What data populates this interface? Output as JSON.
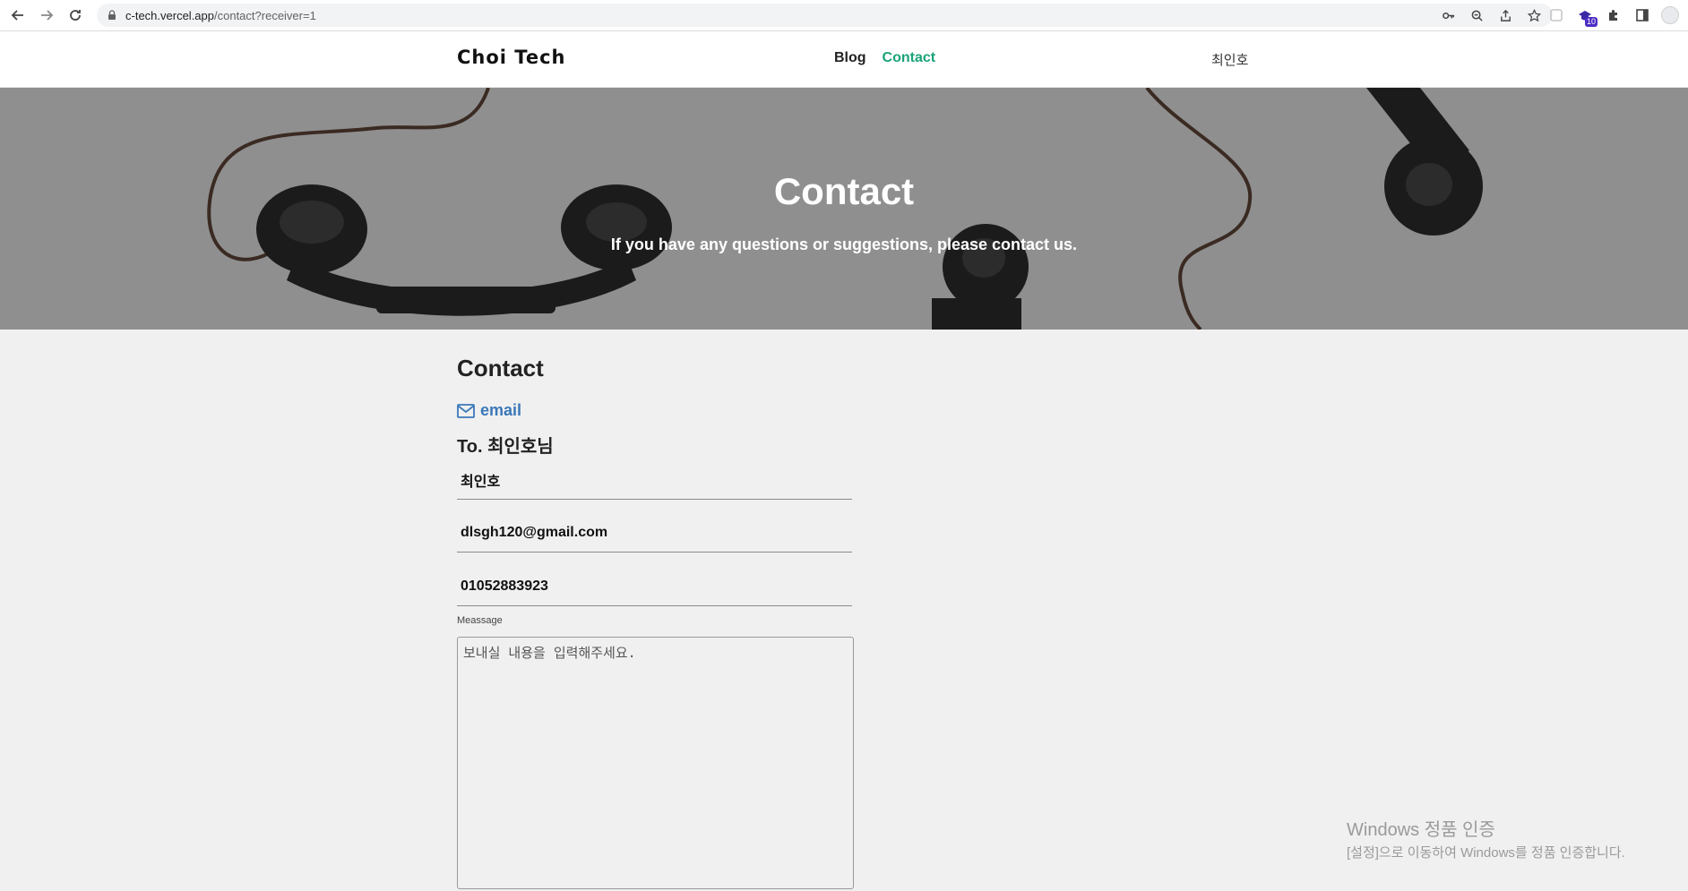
{
  "browser": {
    "url_host": "c-tech.vercel.app",
    "url_path": "/contact?receiver=1",
    "extension_badge": "10",
    "icons": [
      "back-icon",
      "forward-icon",
      "reload-icon",
      "lock-icon",
      "key-icon",
      "zoom-icon",
      "share-icon",
      "bookmark-star-icon",
      "extension-icon",
      "puzzle-icon",
      "sidepanel-icon",
      "profile-icon"
    ]
  },
  "header": {
    "logo": "Choi Tech",
    "nav": [
      {
        "label": "Blog",
        "active": false
      },
      {
        "label": "Contact",
        "active": true
      }
    ],
    "user": "최인호",
    "accent_color": "#1aa37a"
  },
  "hero": {
    "title": "Contact",
    "subtitle": "If you have any questions or suggestions, please contact us."
  },
  "contact": {
    "section_title": "Contact",
    "email_label": "email",
    "to_line": "To. 최인호님",
    "name_value": "최인호",
    "email_value": "dlsgh120@gmail.com",
    "phone_value": "01052883923",
    "message_label": "Meassage",
    "message_placeholder": "보내실 내용을 입력해주세요."
  },
  "watermark": {
    "title": "Windows 정품 인증",
    "subtitle": "[설정]으로 이동하여 Windows를 정품 인증합니다."
  }
}
